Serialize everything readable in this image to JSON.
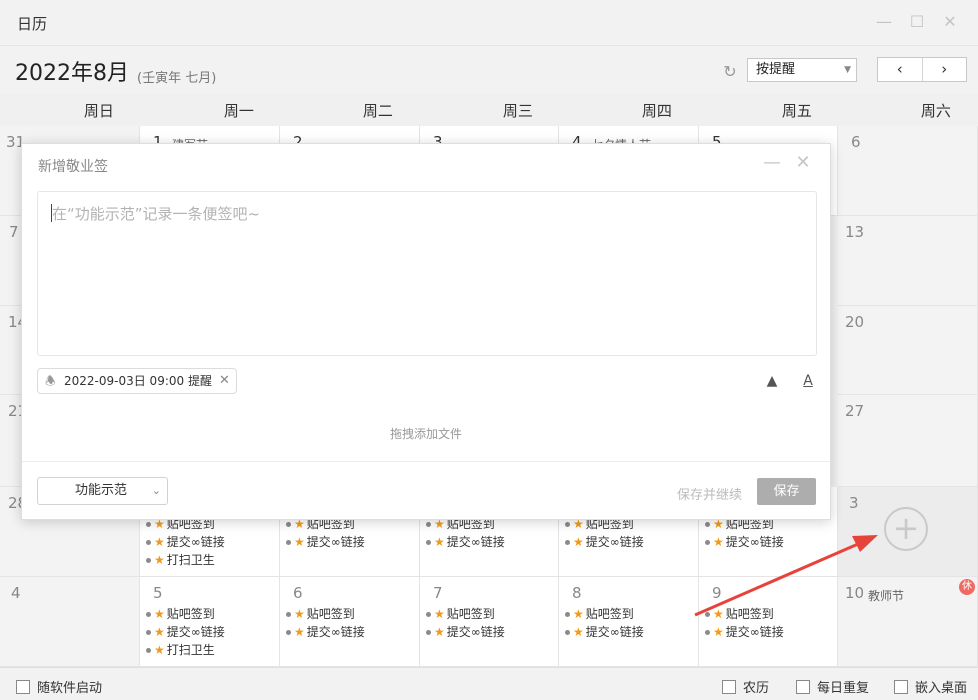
{
  "window": {
    "title": "日历"
  },
  "toolbar": {
    "month_title": "2022年8月",
    "lunar_subtitle": "(壬寅年 七月)",
    "remind_select": "按提醒",
    "prev_label": "‹",
    "next_label": "›"
  },
  "weekdays": [
    "周日",
    "周一",
    "周二",
    "周三",
    "周四",
    "周五",
    "周六"
  ],
  "calendar": {
    "week1": {
      "sun": {
        "day": "31"
      },
      "mon": {
        "day": "1",
        "festival": "建军节"
      },
      "tue": {
        "day": "2"
      },
      "wed": {
        "day": "3"
      },
      "thu": {
        "day": "4",
        "festival": "七夕情人节"
      },
      "fri": {
        "day": "5"
      },
      "sat": {
        "day": "6"
      }
    },
    "week2": {
      "sun": {
        "day": "7"
      },
      "sat": {
        "day": "13"
      }
    },
    "week3": {
      "sun": {
        "day": "14"
      },
      "sat": {
        "day": "20"
      }
    },
    "week4": {
      "sun": {
        "day": "21"
      },
      "sat": {
        "day": "27"
      }
    },
    "week5": {
      "sun": {
        "day": "28"
      },
      "sat": {
        "day": "3"
      },
      "events": {
        "e1": "贴吧签到",
        "e2": "提交∞链接",
        "e3": "打扫卫生"
      }
    },
    "week6": {
      "sun": {
        "day": "4"
      },
      "mon": {
        "day": "5"
      },
      "tue": {
        "day": "6"
      },
      "wed": {
        "day": "7"
      },
      "thu": {
        "day": "8"
      },
      "fri": {
        "day": "9"
      },
      "sat": {
        "day": "10",
        "festival": "教师节",
        "badge": "休"
      },
      "events": {
        "e1": "贴吧签到",
        "e2": "提交∞链接",
        "e3": "打扫卫生"
      }
    }
  },
  "dialog": {
    "title": "新增敬业签",
    "placeholder": "在“功能示范”记录一条便签吧~",
    "remind_time": "2022-09-03日 09:00 提醒",
    "drop_hint": "拖拽添加文件",
    "category": "功能示范",
    "save_continue": "保存并继续",
    "save": "保存"
  },
  "statusbar": {
    "autostart": "随软件启动",
    "lunar": "农历",
    "daily_repeat": "每日重复",
    "embed_desktop": "嵌入桌面"
  },
  "colors": {
    "star": "#f29a18",
    "rest_badge": "#ee6b64",
    "arrow": "#e8433a"
  }
}
